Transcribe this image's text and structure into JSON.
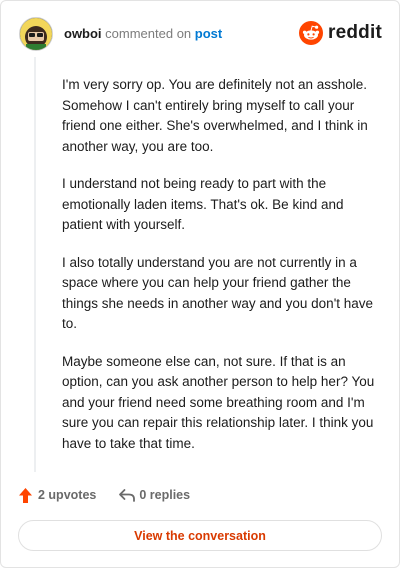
{
  "header": {
    "username": "owboi",
    "commented_text": "commented on",
    "post_link": "post",
    "avatar_icon": "avatar-icon"
  },
  "brand": {
    "name": "reddit",
    "icon": "reddit-logo-icon",
    "color": "#ff4500"
  },
  "comment": {
    "paragraphs": [
      "I'm very sorry op. You are definitely not an asshole. Somehow I can't entirely bring myself to call your friend one either. She's overwhelmed, and I think in another way, you are too.",
      "I understand not being ready to part with the emotionally laden items. That's ok. Be kind and patient with yourself.",
      "I also totally understand you are not currently in a space where you can help your friend gather the things she needs in another way and you don't have to.",
      "Maybe someone else can, not sure. If that is an option, can you ask another person to help her? You and your friend need some breathing room and I'm sure you can repair this relationship later. I think you have to take that time."
    ]
  },
  "footer": {
    "upvotes": "2 upvotes",
    "replies": "0 replies",
    "upvote_icon": "upvote-arrow-icon",
    "reply_icon": "reply-arrow-icon",
    "upvote_color": "#ff4500"
  },
  "cta": {
    "label": "View the conversation",
    "color": "#d93a00"
  }
}
